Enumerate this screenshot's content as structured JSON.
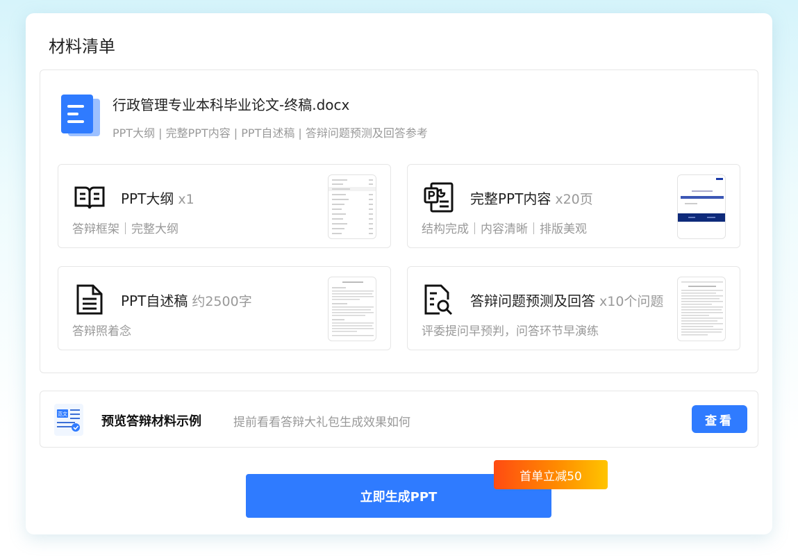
{
  "header": {
    "title": "材料清单"
  },
  "file": {
    "name": "行政管理专业本科毕业论文-终稿.docx",
    "description": "PPT大纲 | 完整PPT内容 | PPT自述稿 | 答辩问题预测及回答参考"
  },
  "items": [
    {
      "name": "PPT大纲",
      "qty": "x1",
      "desc": "答辩框架｜完整大纲",
      "icon": "open-book-icon"
    },
    {
      "name": "完整PPT内容",
      "qty": "x20页",
      "desc": "结构完成｜内容清晰｜排版美观",
      "icon": "ppt-file-icon"
    },
    {
      "name": "PPT自述稿",
      "qty": "约2500字",
      "desc": "答辩照着念",
      "icon": "document-lines-icon"
    },
    {
      "name": "答辩问题预测及回答",
      "qty": "x10个问题",
      "desc": "评委提问早预判，问答环节早演练",
      "icon": "document-search-icon"
    }
  ],
  "preview": {
    "title": "预览答辩材料示例",
    "desc": "提前看看答辩大礼包生成效果如何",
    "button": "查看",
    "icon_label": "范文"
  },
  "cta": {
    "label": "立即生成PPT",
    "badge": "首单立减50"
  },
  "colors": {
    "accent": "#2f7bff",
    "promo_start": "#ff4b12",
    "promo_end": "#ffc400"
  }
}
